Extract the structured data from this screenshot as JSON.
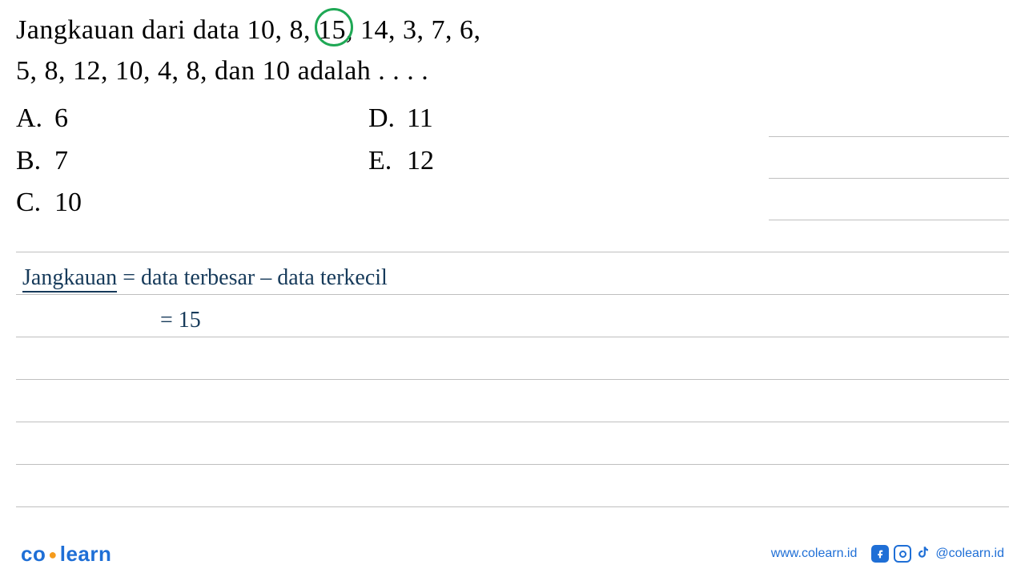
{
  "question": {
    "line1_pre": "Jangkauan dari data 10, 8, ",
    "circled": "15",
    "line1_post": ", 14, 3, 7, 6,",
    "line2": "5, 8, 12, 10, 4, 8, dan 10 adalah . . . ."
  },
  "options": {
    "A": {
      "letter": "A.",
      "value": "6"
    },
    "B": {
      "letter": "B.",
      "value": "7"
    },
    "C": {
      "letter": "C.",
      "value": "10"
    },
    "D": {
      "letter": "D.",
      "value": "11"
    },
    "E": {
      "letter": "E.",
      "value": "12"
    }
  },
  "work": {
    "label": "Jangkauan",
    "formula": " = data terbesar – data terkecil",
    "step2": "= 15"
  },
  "footer": {
    "logo_left": "co",
    "logo_right": "learn",
    "website": "www.colearn.id",
    "handle": "@colearn.id"
  }
}
